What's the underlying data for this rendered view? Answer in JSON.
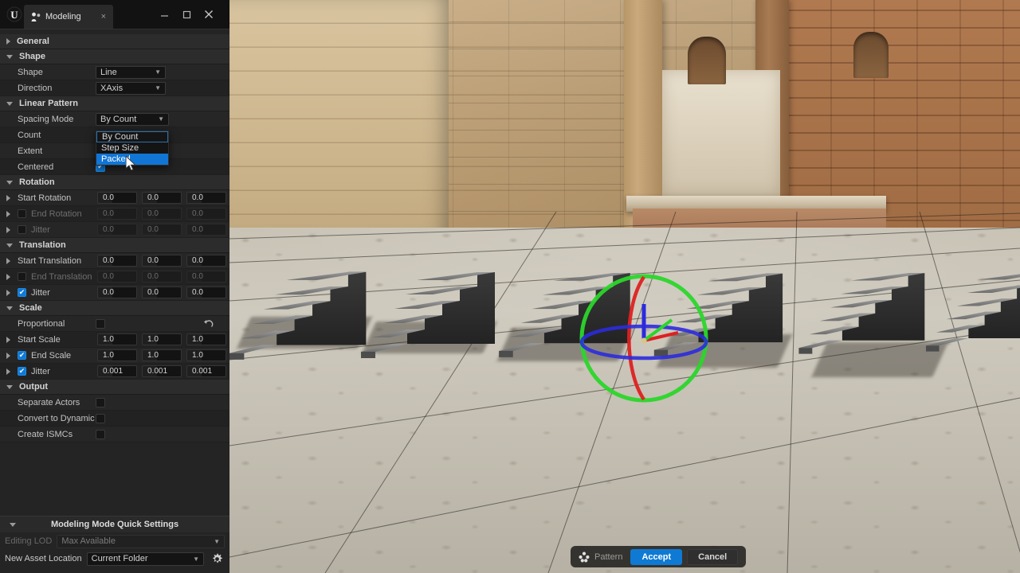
{
  "window": {
    "app_logo": "unreal-engine-logo",
    "tab_label": "Modeling",
    "tab_icon": "modeling-mode-icon",
    "tab_close": "×",
    "minimize": "–",
    "maximize": "□",
    "close": "×"
  },
  "panel": {
    "categories": [
      {
        "name": "General",
        "label": "General",
        "expanded": false
      },
      {
        "name": "Shape",
        "label": "Shape",
        "expanded": true
      },
      {
        "name": "Linear Pattern",
        "label": "Linear Pattern",
        "expanded": true
      },
      {
        "name": "Rotation",
        "label": "Rotation",
        "expanded": true
      },
      {
        "name": "Translation",
        "label": "Translation",
        "expanded": true
      },
      {
        "name": "Scale",
        "label": "Scale",
        "expanded": true
      },
      {
        "name": "Output",
        "label": "Output",
        "expanded": true
      }
    ],
    "shape": {
      "shape_label": "Shape",
      "shape_value": "Line",
      "direction_label": "Direction",
      "direction_value": "XAxis"
    },
    "linear_pattern": {
      "spacing_mode_label": "Spacing Mode",
      "spacing_mode_value": "By Count",
      "count_label": "Count",
      "extent_label": "Extent",
      "centered_label": "Centered",
      "centered_checked": true
    },
    "dropdown": {
      "open": true,
      "options": [
        {
          "label": "By Count",
          "state": "current"
        },
        {
          "label": "Step Size",
          "state": "normal"
        },
        {
          "label": "Packed",
          "state": "hover"
        }
      ]
    },
    "rotation": {
      "start_rotation_label": "Start Rotation",
      "start_rotation": [
        "0.0",
        "0.0",
        "0.0"
      ],
      "end_rotation_label": "End Rotation",
      "end_rotation": [
        "0.0",
        "0.0",
        "0.0"
      ],
      "end_rotation_enabled": false,
      "jitter_label": "Jitter",
      "jitter": [
        "0.0",
        "0.0",
        "0.0"
      ],
      "jitter_enabled": false
    },
    "translation": {
      "start_translation_label": "Start Translation",
      "start_translation": [
        "0.0",
        "0.0",
        "0.0"
      ],
      "end_translation_label": "End Translation",
      "end_translation": [
        "0.0",
        "0.0",
        "0.0"
      ],
      "end_translation_enabled": false,
      "jitter_label": "Jitter",
      "jitter": [
        "0.0",
        "0.0",
        "0.0"
      ],
      "jitter_enabled": true
    },
    "scale": {
      "proportional_label": "Proportional",
      "proportional_checked": false,
      "reset_icon": "reset-arrow-icon",
      "start_scale_label": "Start Scale",
      "start_scale": [
        "1.0",
        "1.0",
        "1.0"
      ],
      "end_scale_label": "End Scale",
      "end_scale": [
        "1.0",
        "1.0",
        "1.0"
      ],
      "end_scale_enabled": true,
      "jitter_label": "Jitter",
      "jitter": [
        "0.001",
        "0.001",
        "0.001"
      ],
      "jitter_enabled": true
    },
    "output": {
      "separate_actors_label": "Separate Actors",
      "separate_actors_checked": false,
      "convert_to_dynamic_label": "Convert to Dynamic",
      "convert_to_dynamic_checked": false,
      "create_ismcs_label": "Create ISMCs",
      "create_ismcs_checked": false
    }
  },
  "quick_settings": {
    "title": "Modeling Mode Quick Settings",
    "editing_lod_label": "Editing LOD",
    "editing_lod_value": "Max Available",
    "new_asset_location_label": "New Asset Location",
    "new_asset_location_value": "Current Folder",
    "gear_icon": "gear-icon"
  },
  "viewport": {
    "accept_bar": {
      "pattern_icon": "pattern-dots-icon",
      "pattern_label": "Pattern",
      "accept_label": "Accept",
      "cancel_label": "Cancel"
    },
    "gizmo": "rotation-gizmo"
  },
  "colors": {
    "accent_blue": "#0e7ad4",
    "highlight_blue": "#1175d6",
    "panel_bg": "#242424",
    "titlebar_bg": "#121212",
    "gizmo_green": "#22dd22",
    "gizmo_red": "#dd2222",
    "gizmo_blue": "#2222dd"
  }
}
